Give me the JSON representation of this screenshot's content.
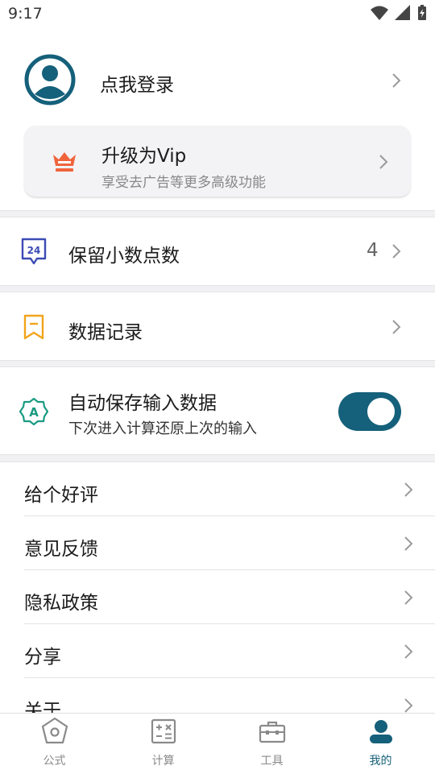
{
  "status": {
    "time": "9:17"
  },
  "profile": {
    "login_label": "点我登录"
  },
  "vip": {
    "title": "升级为Vip",
    "subtitle": "享受去广告等更多高级功能"
  },
  "settings": {
    "decimals": {
      "label": "保留小数点数",
      "value": "4"
    },
    "records": {
      "label": "数据记录"
    },
    "autosave": {
      "label": "自动保存输入数据",
      "desc": "下次进入计算还原上次的输入",
      "enabled": true
    }
  },
  "menu": {
    "items": [
      {
        "label": "给个好评"
      },
      {
        "label": "意见反馈"
      },
      {
        "label": "隐私政策"
      },
      {
        "label": "分享"
      },
      {
        "label": "关于"
      }
    ]
  },
  "tabs": [
    {
      "label": "公式",
      "icon": "formula-icon"
    },
    {
      "label": "计算",
      "icon": "calculator-icon"
    },
    {
      "label": "工具",
      "icon": "toolbox-icon"
    },
    {
      "label": "我的",
      "icon": "user-icon",
      "active": true
    }
  ],
  "colors": {
    "accent": "#15607a",
    "vip": "#f0643c",
    "records": "#f2a41b",
    "decimals": "#3b4bb4",
    "autosave": "#1a9a82"
  }
}
